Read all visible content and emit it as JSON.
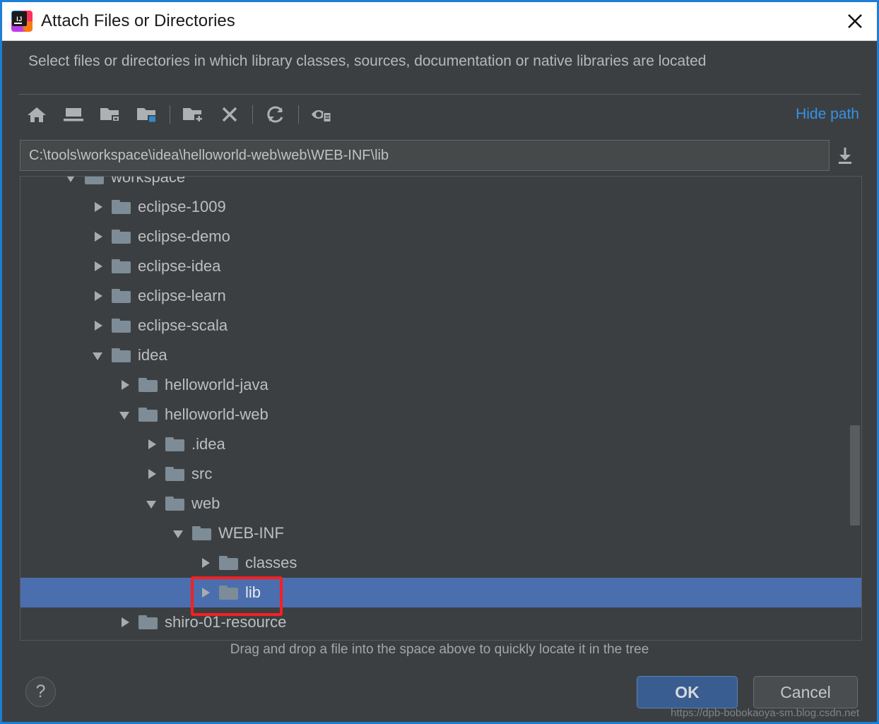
{
  "window": {
    "title": "Attach Files or Directories",
    "logo_icon": "intellij-idea-logo",
    "logo_text": "IJ",
    "close_icon": "close-icon",
    "accent_border_color": "#1d7fd4"
  },
  "subtitle": "Select files or directories in which library classes, sources, documentation or native libraries are located",
  "toolbar": {
    "buttons": [
      {
        "name": "home-icon",
        "tooltip": "Home"
      },
      {
        "name": "desktop-icon",
        "tooltip": "Desktop"
      },
      {
        "name": "project-folder-icon",
        "tooltip": "Project directory"
      },
      {
        "name": "module-folder-icon",
        "tooltip": "Module directory"
      },
      {
        "name": "new-folder-icon",
        "tooltip": "New Folder"
      },
      {
        "name": "delete-icon",
        "tooltip": "Delete"
      },
      {
        "name": "refresh-icon",
        "tooltip": "Refresh"
      },
      {
        "name": "show-hidden-icon",
        "tooltip": "Show hidden files and directories"
      }
    ],
    "hide_path_label": "Hide path"
  },
  "path": {
    "value": "C:\\tools\\workspace\\idea\\helloworld-web\\web\\WEB-INF\\lib",
    "placeholder": "",
    "download_icon": "arrow-down-to-line-icon"
  },
  "tree": {
    "rows": [
      {
        "label": "workspace",
        "indent": 1,
        "state": "expanded",
        "selected": false,
        "clipped": true
      },
      {
        "label": "eclipse-1009",
        "indent": 2,
        "state": "collapsed",
        "selected": false
      },
      {
        "label": "eclipse-demo",
        "indent": 2,
        "state": "collapsed",
        "selected": false
      },
      {
        "label": "eclipse-idea",
        "indent": 2,
        "state": "collapsed",
        "selected": false
      },
      {
        "label": "eclipse-learn",
        "indent": 2,
        "state": "collapsed",
        "selected": false
      },
      {
        "label": "eclipse-scala",
        "indent": 2,
        "state": "collapsed",
        "selected": false
      },
      {
        "label": "idea",
        "indent": 2,
        "state": "expanded",
        "selected": false
      },
      {
        "label": "helloworld-java",
        "indent": 3,
        "state": "collapsed",
        "selected": false
      },
      {
        "label": "helloworld-web",
        "indent": 3,
        "state": "expanded",
        "selected": false
      },
      {
        "label": ".idea",
        "indent": 4,
        "state": "collapsed",
        "selected": false
      },
      {
        "label": "src",
        "indent": 4,
        "state": "collapsed",
        "selected": false
      },
      {
        "label": "web",
        "indent": 4,
        "state": "expanded",
        "selected": false
      },
      {
        "label": "WEB-INF",
        "indent": 5,
        "state": "expanded",
        "selected": false
      },
      {
        "label": "classes",
        "indent": 6,
        "state": "collapsed",
        "selected": false
      },
      {
        "label": "lib",
        "indent": 6,
        "state": "collapsed",
        "selected": true
      },
      {
        "label": "shiro-01-resource",
        "indent": 3,
        "state": "collapsed",
        "selected": false
      }
    ],
    "selection_color": "#4b6eaf",
    "annotation_color": "#f81f20"
  },
  "hint": "Drag and drop a file into the space above to quickly locate it in the tree",
  "footer": {
    "help_label": "?",
    "ok_label": "OK",
    "cancel_label": "Cancel",
    "ok_color": "#3a5d91"
  },
  "watermark": "https://dpb-bobokaoya-sm.blog.csdn.net"
}
